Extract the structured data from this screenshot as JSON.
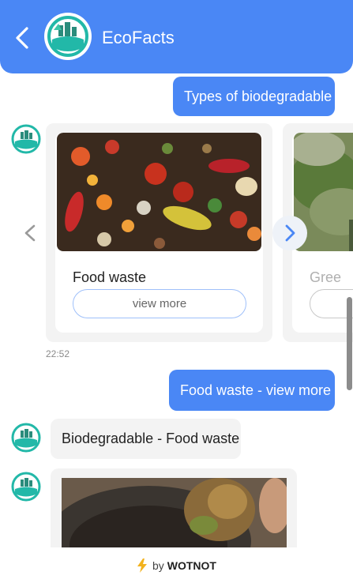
{
  "header": {
    "title": "EcoFacts",
    "back_icon": "chevron-left-icon",
    "logo_icon": "eco-globe-logo",
    "bg_color": "#4a87f5"
  },
  "messages": {
    "user_1": "Types of biodegradable",
    "user_2": "Food waste - view more",
    "bot_1": "Biodegradable - Food waste",
    "timestamp_1": "22:52"
  },
  "carousel": {
    "cards": [
      {
        "title": "Food waste",
        "button": "view more",
        "image": "food-waste-image"
      },
      {
        "title": "Gree",
        "button": "",
        "image": "green-waste-image"
      }
    ],
    "prev_icon": "chevron-left-icon",
    "next_icon": "chevron-right-icon"
  },
  "footer": {
    "icon": "lightning-icon",
    "by": "by",
    "brand": "WOTNOT"
  },
  "colors": {
    "accent": "#4a87f5",
    "bot_bubble": "#f3f3f3",
    "button_border": "#9fc0fa"
  }
}
